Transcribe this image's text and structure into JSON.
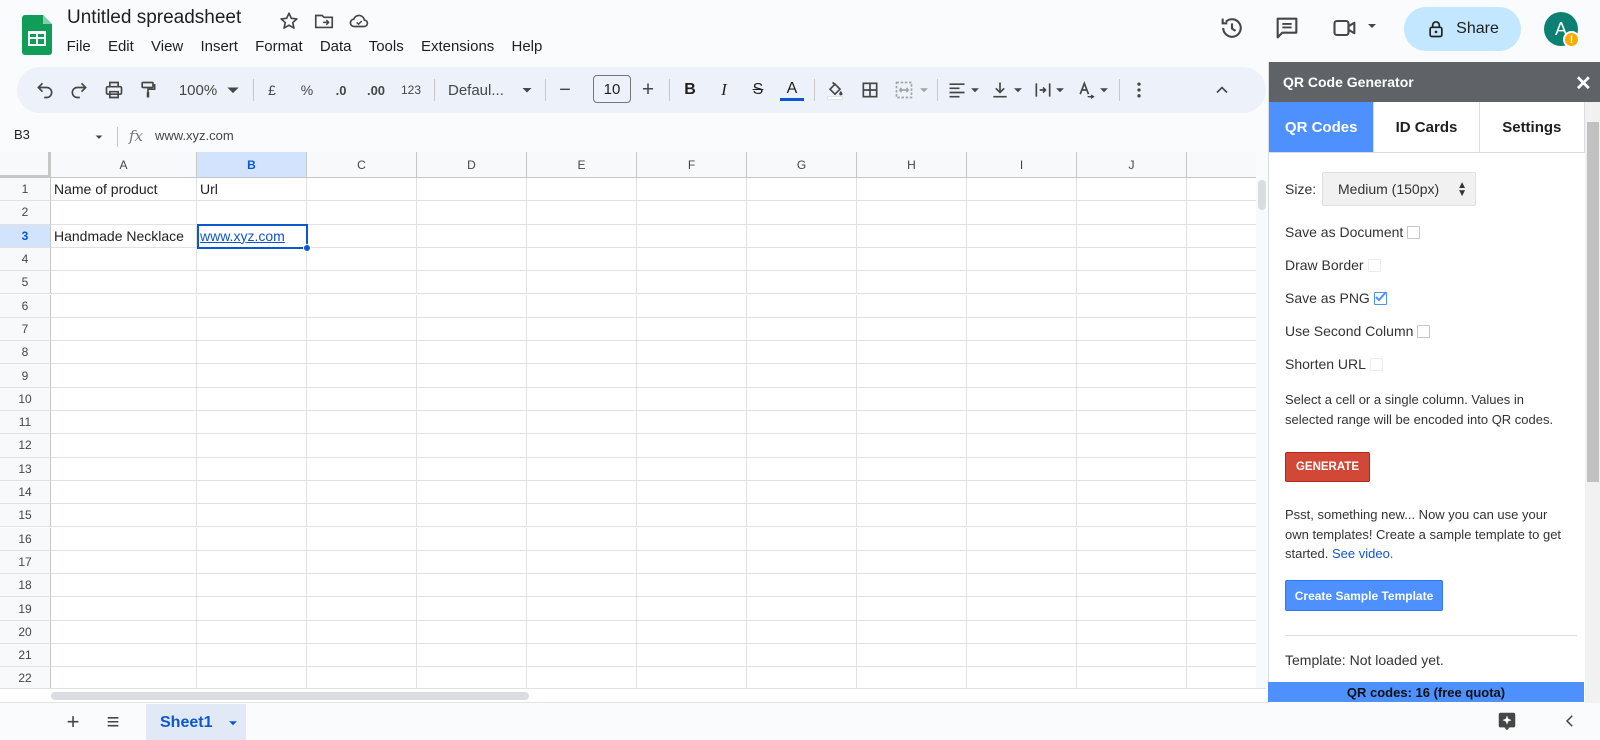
{
  "app": {
    "doc_title": "Untitled spreadsheet",
    "menus": [
      "File",
      "Edit",
      "View",
      "Insert",
      "Format",
      "Data",
      "Tools",
      "Extensions",
      "Help"
    ],
    "share_label": "Share",
    "avatar_letter": "A",
    "avatar_warning": "!"
  },
  "toolbar": {
    "zoom": "100%",
    "currency": "£",
    "percent": "%",
    "decrease_decimal": ".0",
    "increase_decimal": ".00",
    "number_format": "123",
    "font": "Defaul...",
    "minus": "−",
    "font_size": "10",
    "plus": "+",
    "bold": "B",
    "italic": "I",
    "strikethrough": "S",
    "text_color": "A"
  },
  "formula_bar": {
    "name_box": "B3",
    "fx": "fx",
    "value": "www.xyz.com"
  },
  "grid": {
    "columns": [
      "A",
      "B",
      "C",
      "D",
      "E",
      "F",
      "G",
      "H",
      "I",
      "J"
    ],
    "rows": [
      "1",
      "2",
      "3",
      "4",
      "5",
      "6",
      "7",
      "8",
      "9",
      "10",
      "11",
      "12",
      "13",
      "14",
      "15",
      "16",
      "17",
      "18",
      "19",
      "20",
      "21",
      "22"
    ],
    "selected_cell": "B3",
    "cells": {
      "A1": "Name of product",
      "B1": "Url",
      "A3": "Handmade Necklace",
      "B3": "www.xyz.com"
    }
  },
  "sheets": {
    "active_tab": "Sheet1",
    "add_label": "+",
    "list_label": "≡"
  },
  "qr_panel": {
    "title": "QR Code Generator",
    "close_label": "✕",
    "tabs": [
      "QR Codes",
      "ID Cards",
      "Settings"
    ],
    "active_tab": "QR Codes",
    "size_label": "Size:",
    "size_value": "Medium (150px)",
    "options": [
      {
        "label": "Save as Document",
        "checked": false
      },
      {
        "label": "Draw Border",
        "checked": false
      },
      {
        "label": "Save as PNG",
        "checked": true
      },
      {
        "label": "Use Second Column",
        "checked": false
      },
      {
        "label": "Shorten URL",
        "checked": false
      }
    ],
    "instruction": "Select a cell or a single column. Values in selected range will be encoded into QR codes.",
    "generate_label": "GENERATE",
    "news_text": "Psst, something new... Now you can use your own templates! Create a sample template to get started.",
    "news_link": "See video.",
    "sample_template_label": "Create Sample Template",
    "template_status": "Template: Not loaded yet.",
    "quota": "QR codes: 16 (free quota)"
  },
  "colors": {
    "accent": "#0b57d0",
    "share_bg": "#c2e7ff",
    "panel_tab_active": "#4d90fe",
    "generate": "#d14836",
    "sheets_green": "#0f9d58"
  }
}
